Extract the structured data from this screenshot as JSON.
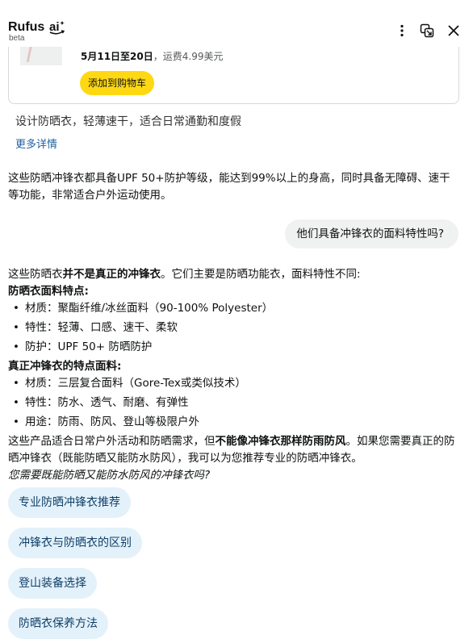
{
  "header": {
    "brand": "Rufus",
    "beta": "beta"
  },
  "product": {
    "shipping_dates": "5月11日至20日",
    "shipping_rest": "，运费4.99美元",
    "add_to_cart": "添加到购物车",
    "description": "设计防晒衣，轻薄速干，适合日常通勤和度假",
    "more_details": "更多详情"
  },
  "messages": {
    "assistant_1": "这些防晒冲锋衣都具备UPF 50+防护等级，能达到99%以上的身高，同时具备无障碍、速干等功能，非常适合户外运动使用。",
    "user_1": "他们具备冲锋衣的面料特性吗?",
    "answer": {
      "intro_a": "这些防晒衣",
      "intro_b": "并不是真正的冲锋衣",
      "intro_c": "。它们主要是防晒功能衣，面料特性不同:",
      "section1_title": "防晒衣面料特点:",
      "section1_items": [
        "材质：聚酯纤维/冰丝面料（90-100% Polyester）",
        "特性：轻薄、口感、速干、柔软",
        "防护：UPF 50+ 防晒防护"
      ],
      "section2_title": "真正冲锋衣的特点面料:",
      "section2_items": [
        "材质：三层复合面料（Gore-Tex或类似技术）",
        "特性：防水、透气、耐磨、有弹性",
        "用途：防雨、防风、登山等极限户外"
      ],
      "closing_a": "这些产品适合日常户外活动和防晒需求，但",
      "closing_b": "不能像冲锋衣那样防雨防风",
      "closing_c": "。如果您需要真正的防晒冲锋衣（既能防晒又能防水防风），我可以为您推荐专业的防晒冲锋衣。",
      "question": "您需要既能防晒又能防水防风的冲锋衣吗?"
    }
  },
  "suggestions": [
    "专业防晒冲锋衣推荐",
    "冲锋衣与防晒衣的区别",
    "登山装备选择",
    "防晒衣保养方法"
  ],
  "colors": {
    "cart_button": "#ffd814",
    "chip_bg": "#e3f1fb",
    "link": "#2162a1"
  }
}
